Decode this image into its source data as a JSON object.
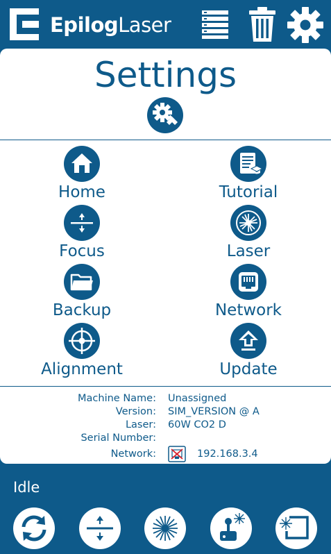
{
  "brand": {
    "bold": "Epilog",
    "light": "Laser"
  },
  "header": {
    "icons": [
      "job-list-icon",
      "trash-icon",
      "gear-icon"
    ]
  },
  "page": {
    "title": "Settings"
  },
  "menu": [
    {
      "label": "Home",
      "icon": "home-icon"
    },
    {
      "label": "Tutorial",
      "icon": "tutorial-icon"
    },
    {
      "label": "Focus",
      "icon": "focus-icon"
    },
    {
      "label": "Laser",
      "icon": "laser-icon"
    },
    {
      "label": "Backup",
      "icon": "folder-icon"
    },
    {
      "label": "Network",
      "icon": "ethernet-icon"
    },
    {
      "label": "Alignment",
      "icon": "crosshair-icon"
    },
    {
      "label": "Update",
      "icon": "upload-arrow-icon"
    }
  ],
  "info": {
    "machine_name_label": "Machine Name:",
    "machine_name": "Unassigned",
    "version_label": "Version:",
    "version": "SIM_VERSION @ A",
    "laser_label": "Laser:",
    "laser": "60W CO2 D",
    "serial_label": "Serial Number:",
    "serial": "",
    "network_label": "Network:",
    "network_ip": "192.168.3.4"
  },
  "status": "Idle",
  "bottom_buttons": [
    "refresh-icon",
    "focus-icon",
    "laser-fire-icon",
    "joystick-icon",
    "frame-laser-icon"
  ],
  "colors": {
    "primary": "#0e5a8a",
    "panel": "#ffffff",
    "error": "#d9232d"
  }
}
